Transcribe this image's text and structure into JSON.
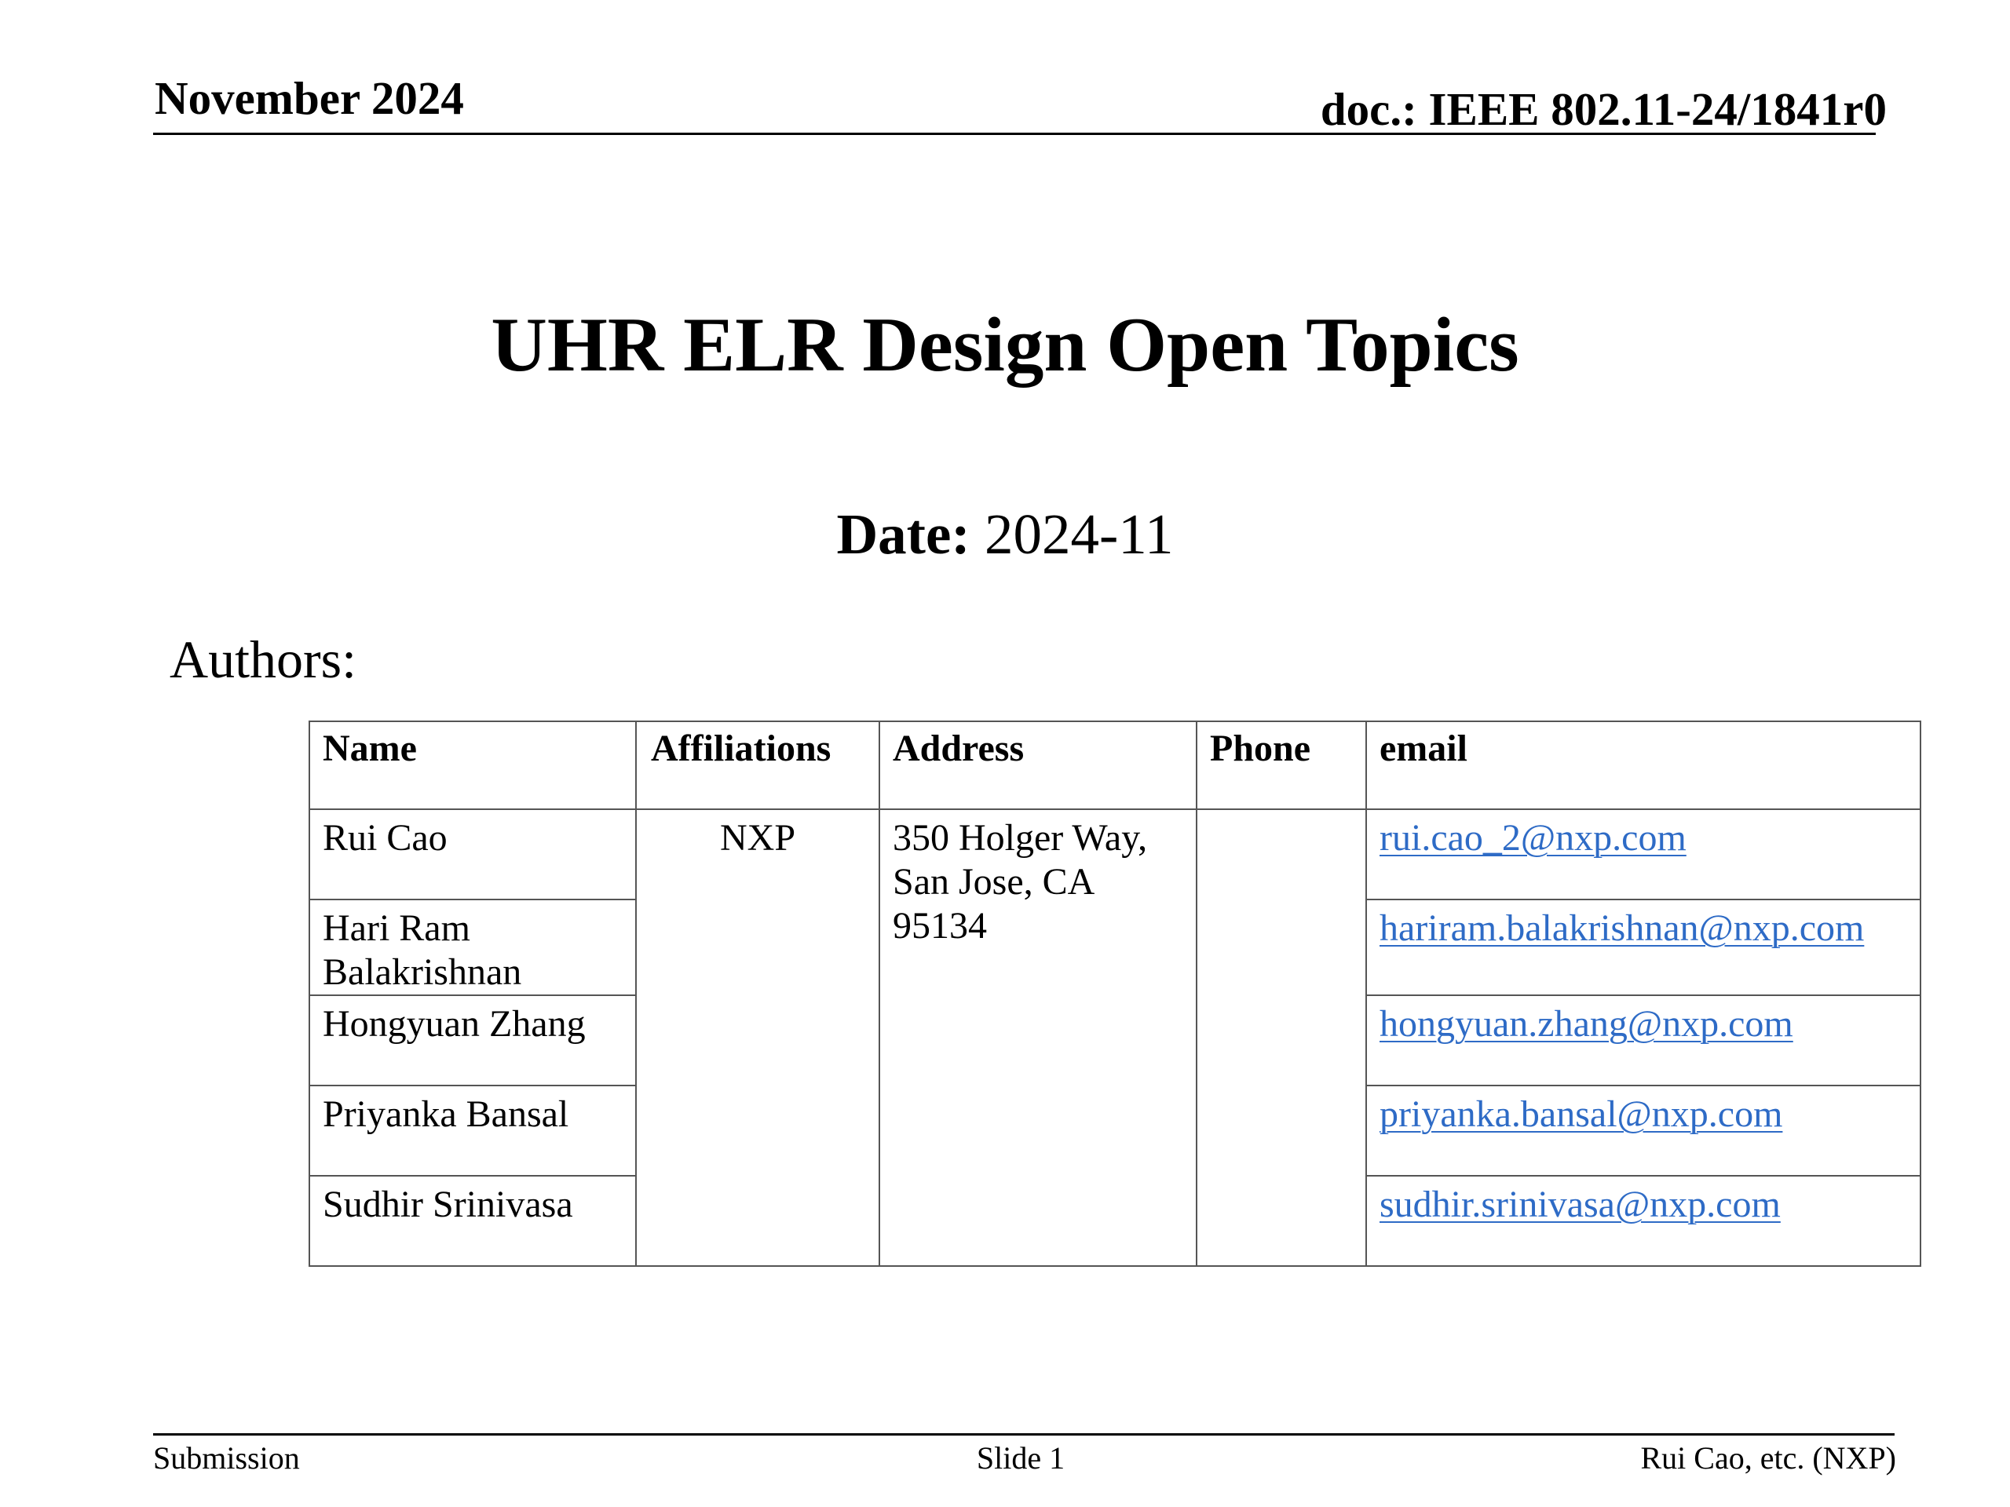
{
  "header": {
    "date": "November 2024",
    "doc_id": "doc.: IEEE 802.11-24/1841r0"
  },
  "title": "UHR ELR Design Open Topics",
  "date_line": {
    "label": "Date:",
    "value": "2024-11"
  },
  "authors_label": "Authors:",
  "authors_table": {
    "columns": [
      "Name",
      "Affiliations",
      "Address",
      "Phone",
      "email"
    ],
    "affiliation": "NXP",
    "address": "350 Holger Way, San Jose, CA 95134",
    "phone": "",
    "rows": [
      {
        "name": "Rui Cao",
        "email": "rui.cao_2@nxp.com"
      },
      {
        "name": "Hari Ram Balakrishnan",
        "email": "hariram.balakrishnan@nxp.com"
      },
      {
        "name": "Hongyuan Zhang",
        "email": "hongyuan.zhang@nxp.com"
      },
      {
        "name": "Priyanka Bansal",
        "email": "priyanka.bansal@nxp.com"
      },
      {
        "name": "Sudhir Srinivasa",
        "email": "sudhir.srinivasa@nxp.com"
      }
    ]
  },
  "footer": {
    "left": "Submission",
    "center": "Slide 1",
    "right": "Rui Cao, etc. (NXP)"
  },
  "colors": {
    "link": "#2e6bc6",
    "table_border": "#555555"
  }
}
